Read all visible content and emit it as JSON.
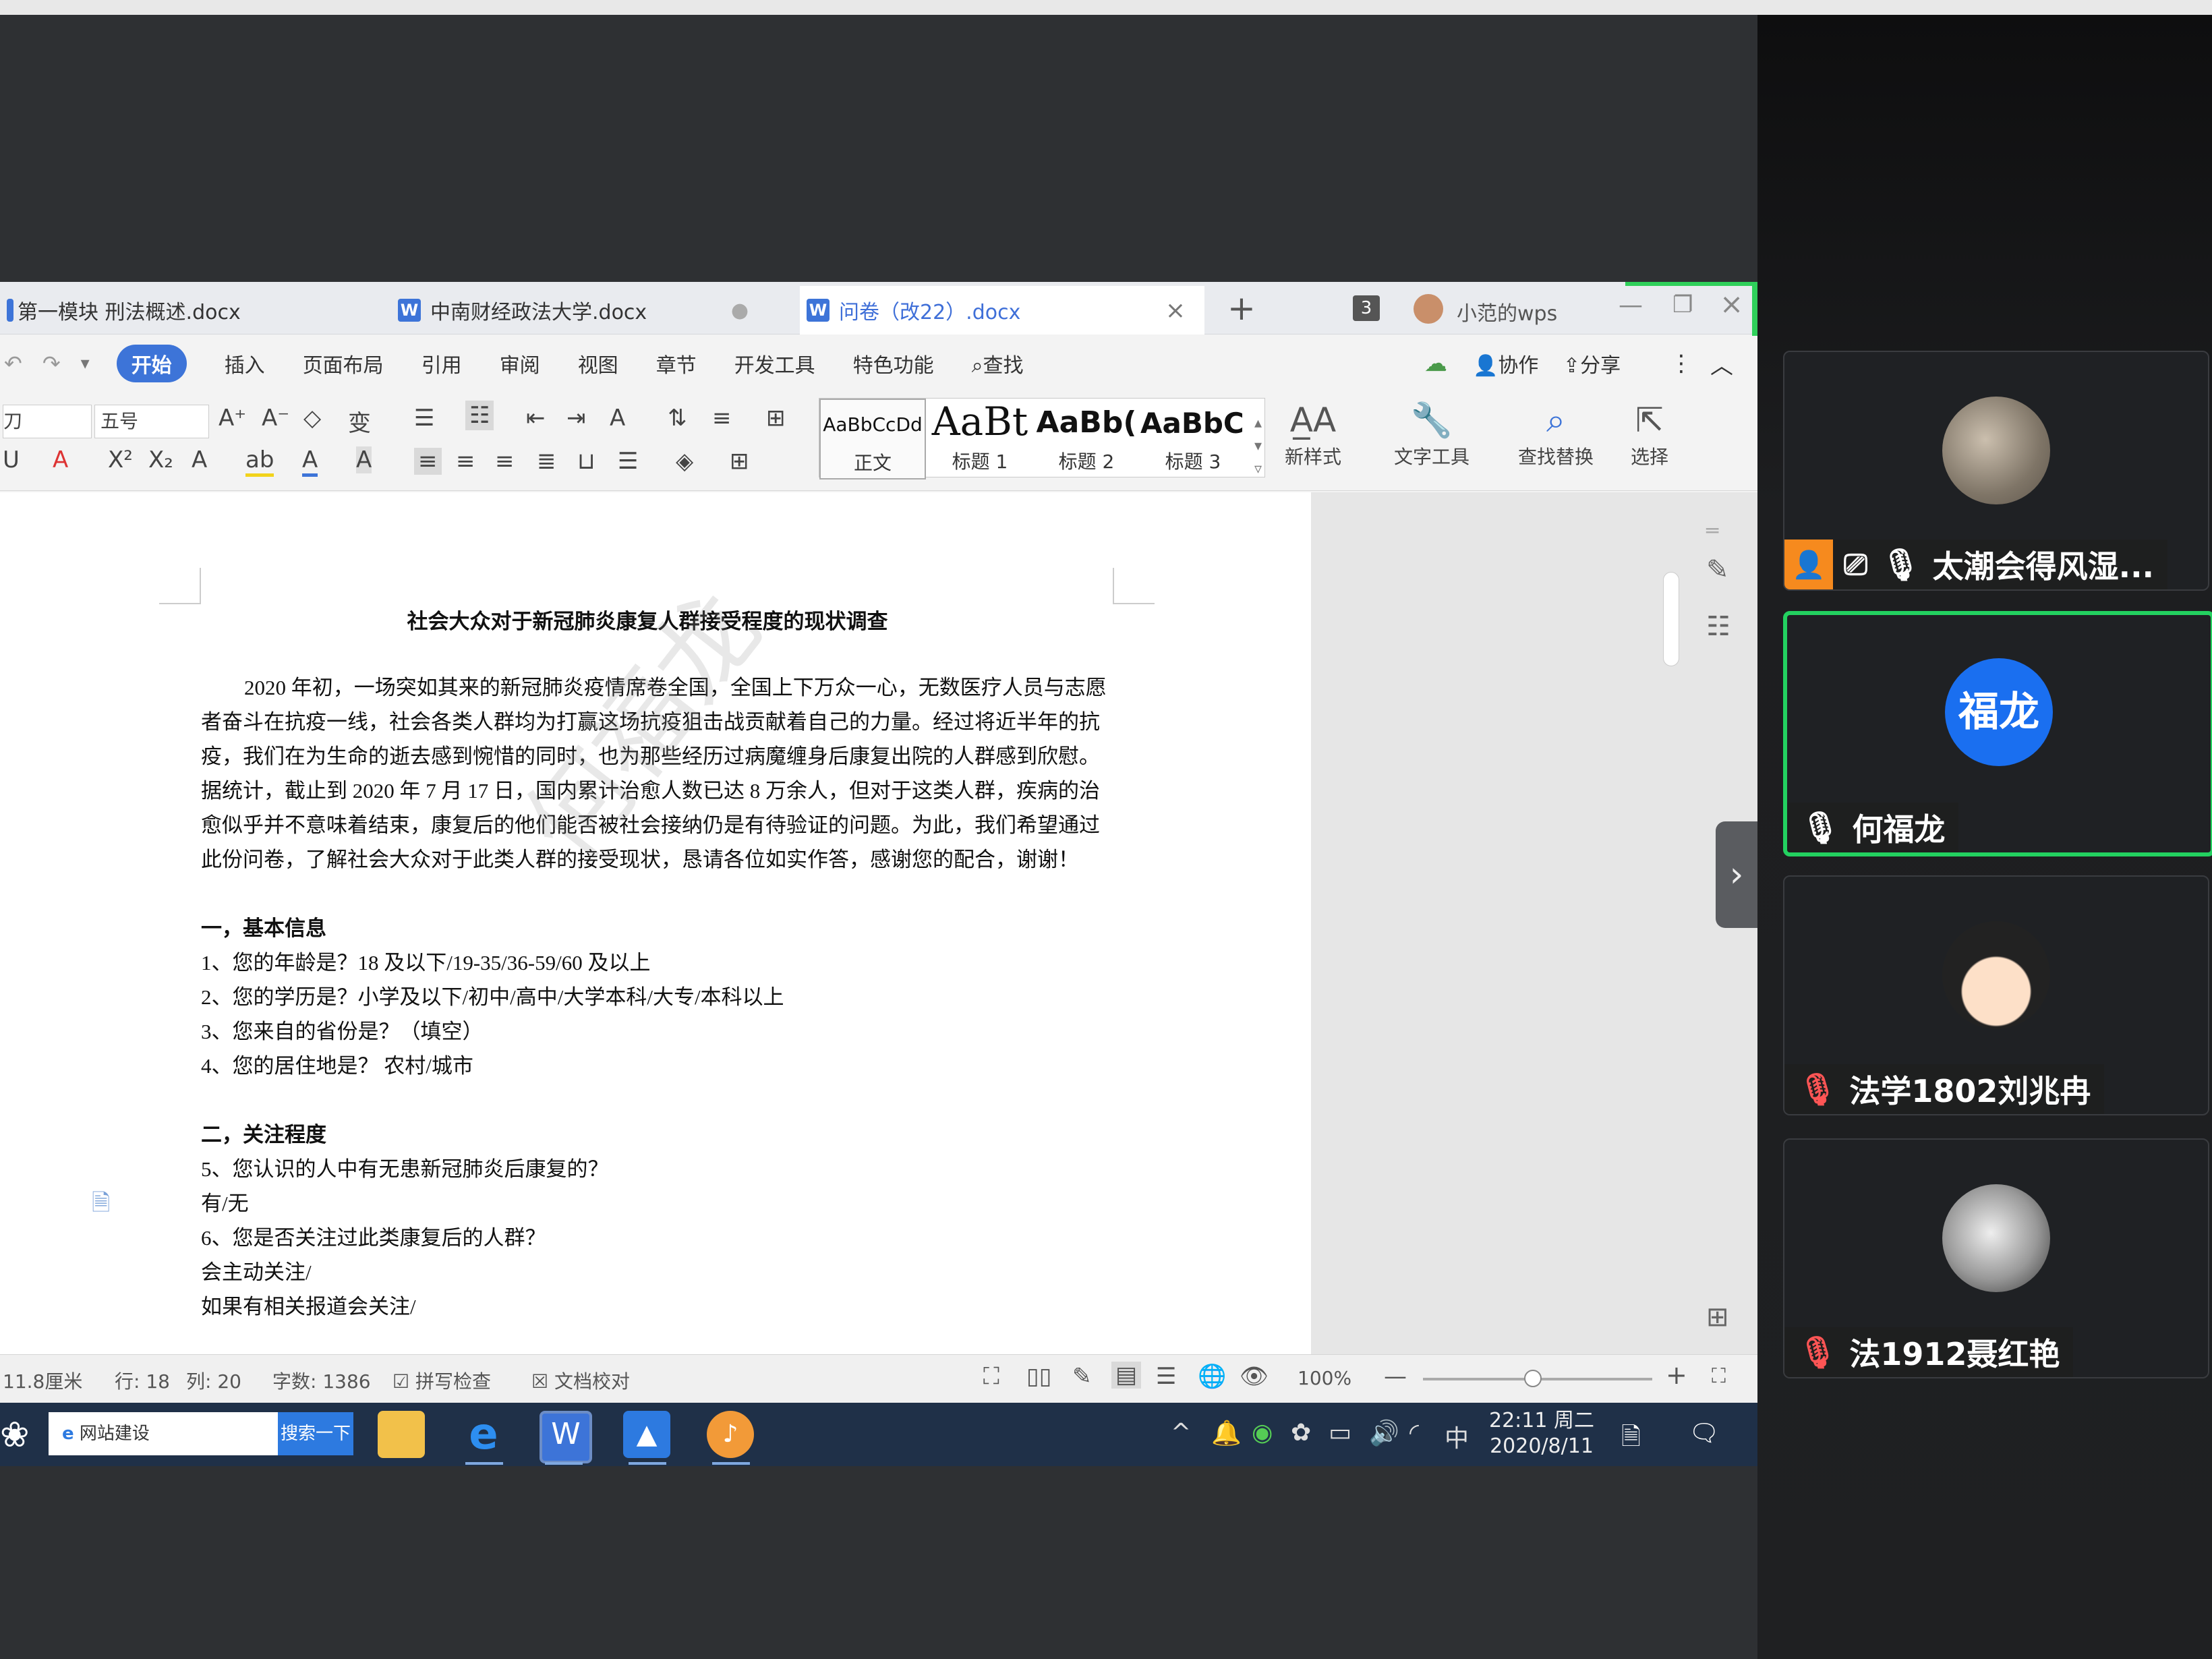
{
  "wps": {
    "tabs": [
      {
        "label": "第一模块 刑法概述.docx"
      },
      {
        "label": "中南财经政法大学.docx"
      },
      {
        "label": "问卷（改22）.docx"
      }
    ],
    "tab_count_badge": "3",
    "user_label": "小范的wps",
    "menu": [
      "开始",
      "插入",
      "页面布局",
      "引用",
      "审阅",
      "视图",
      "章节",
      "开发工具",
      "特色功能",
      "查找"
    ],
    "menu_right": {
      "collab": "协作",
      "share": "分享"
    },
    "ribbon": {
      "font_size": "五号",
      "styles": [
        {
          "preview": "AaBbCcDd",
          "label": "正文"
        },
        {
          "preview": "AaBt",
          "label": "标题 1"
        },
        {
          "preview": "AaBb(",
          "label": "标题 2"
        },
        {
          "preview": "AaBbC(",
          "label": "标题 3"
        }
      ],
      "tools": [
        "新样式",
        "文字工具",
        "查找替换",
        "选择"
      ]
    },
    "document": {
      "title": "社会大众对于新冠肺炎康复人群接受程度的现状调查",
      "intro": "2020 年初，一场突如其来的新冠肺炎疫情席卷全国，全国上下万众一心，无数医疗人员与志愿者奋斗在抗疫一线，社会各类人群均为打赢这场抗疫狙击战贡献着自己的力量。经过将近半年的抗疫，我们在为生命的逝去感到惋惜的同时，也为那些经历过病魔缠身后康复出院的人群感到欣慰。据统计，截止到 2020 年 7 月 17 日，国内累计治愈人数已达 8 万余人，但对于这类人群，疾病的治愈似乎并不意味着结束，康复后的他们能否被社会接纳仍是有待验证的问题。为此，我们希望通过此份问卷，了解社会大众对于此类人群的接受现状，恳请各位如实作答，感谢您的配合，谢谢！",
      "section1": "一，基本信息",
      "q1": "1、您的年龄是？18 及以下/19-35/36-59/60 及以上",
      "q2": "2、您的学历是？小学及以下/初中/高中/大学本科/大专/本科以上",
      "q3": "3、您来自的省份是？（填空）",
      "q4": "4、您的居住地是？  农村/城市",
      "section2": "二，关注程度",
      "q5": "5、您认识的人中有无患新冠肺炎后康复的？",
      "a5": "有/无",
      "q6": "6、您是否关注过此类康复后的人群？",
      "a6a": "会主动关注/",
      "a6b": "如果有相关报道会关注/"
    },
    "watermark": "何福龙",
    "status": {
      "pos": "11.8厘米",
      "line": "行: 18",
      "col": "列: 20",
      "words": "字数: 1386",
      "spell": "拼写检查",
      "proof": "文档校对",
      "zoom": "100%"
    }
  },
  "taskbar": {
    "search_text": "网站建设",
    "search_button": "搜索一下",
    "ime": "中",
    "time": "22:11 周二",
    "date": "2020/8/11"
  },
  "participants": [
    {
      "name": "太潮会得风湿...",
      "muted": false,
      "sharing": true
    },
    {
      "name": "何福龙",
      "avatar_text": "福龙",
      "muted": false,
      "speaking": true
    },
    {
      "name": "法学1802刘兆冉",
      "muted": true
    },
    {
      "name": "法1912聂红艳",
      "muted": true
    }
  ],
  "colors": {
    "accent_blue": "#3d74d8",
    "speaking_green": "#23d160",
    "taskbar": "#1f3048",
    "badge_orange": "#f68a1e"
  }
}
